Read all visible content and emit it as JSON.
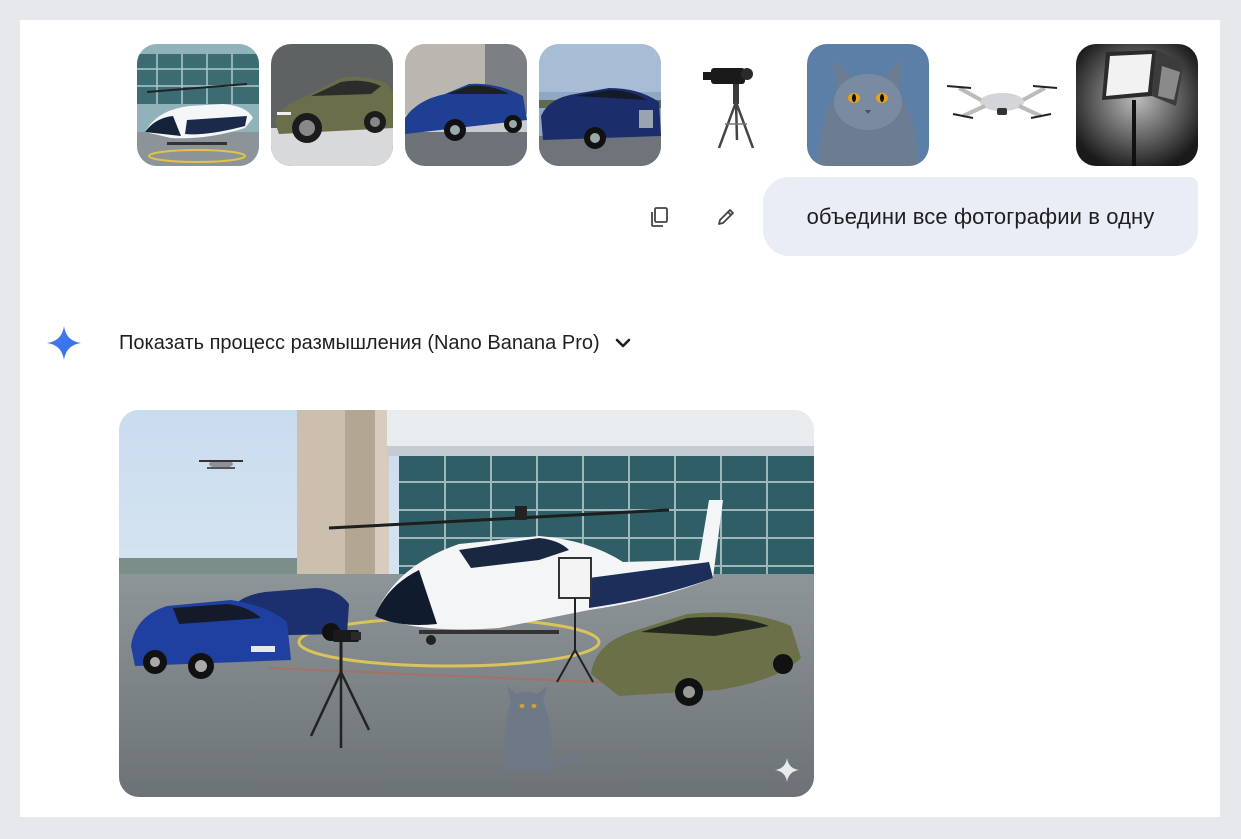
{
  "attachments": [
    {
      "name": "helicopter-photo"
    },
    {
      "name": "green-sedan-photo"
    },
    {
      "name": "blue-sedan-photo"
    },
    {
      "name": "blue-limousine-photo"
    },
    {
      "name": "camera-tripod-photo"
    },
    {
      "name": "cat-photo"
    },
    {
      "name": "drone-photo"
    },
    {
      "name": "studio-light-photo"
    }
  ],
  "user_message": {
    "text": "объедини все фотографии в одну"
  },
  "actions": {
    "copy_icon": "copy-icon",
    "edit_icon": "pencil-icon"
  },
  "response": {
    "thinking_label": "Показать процесс размышления (Nano Banana Pro)",
    "result_image": "combined-scene-image"
  },
  "colors": {
    "bubble_bg": "#e9eef6",
    "accent_blue": "#4285f4",
    "text": "#1f1f1f"
  }
}
